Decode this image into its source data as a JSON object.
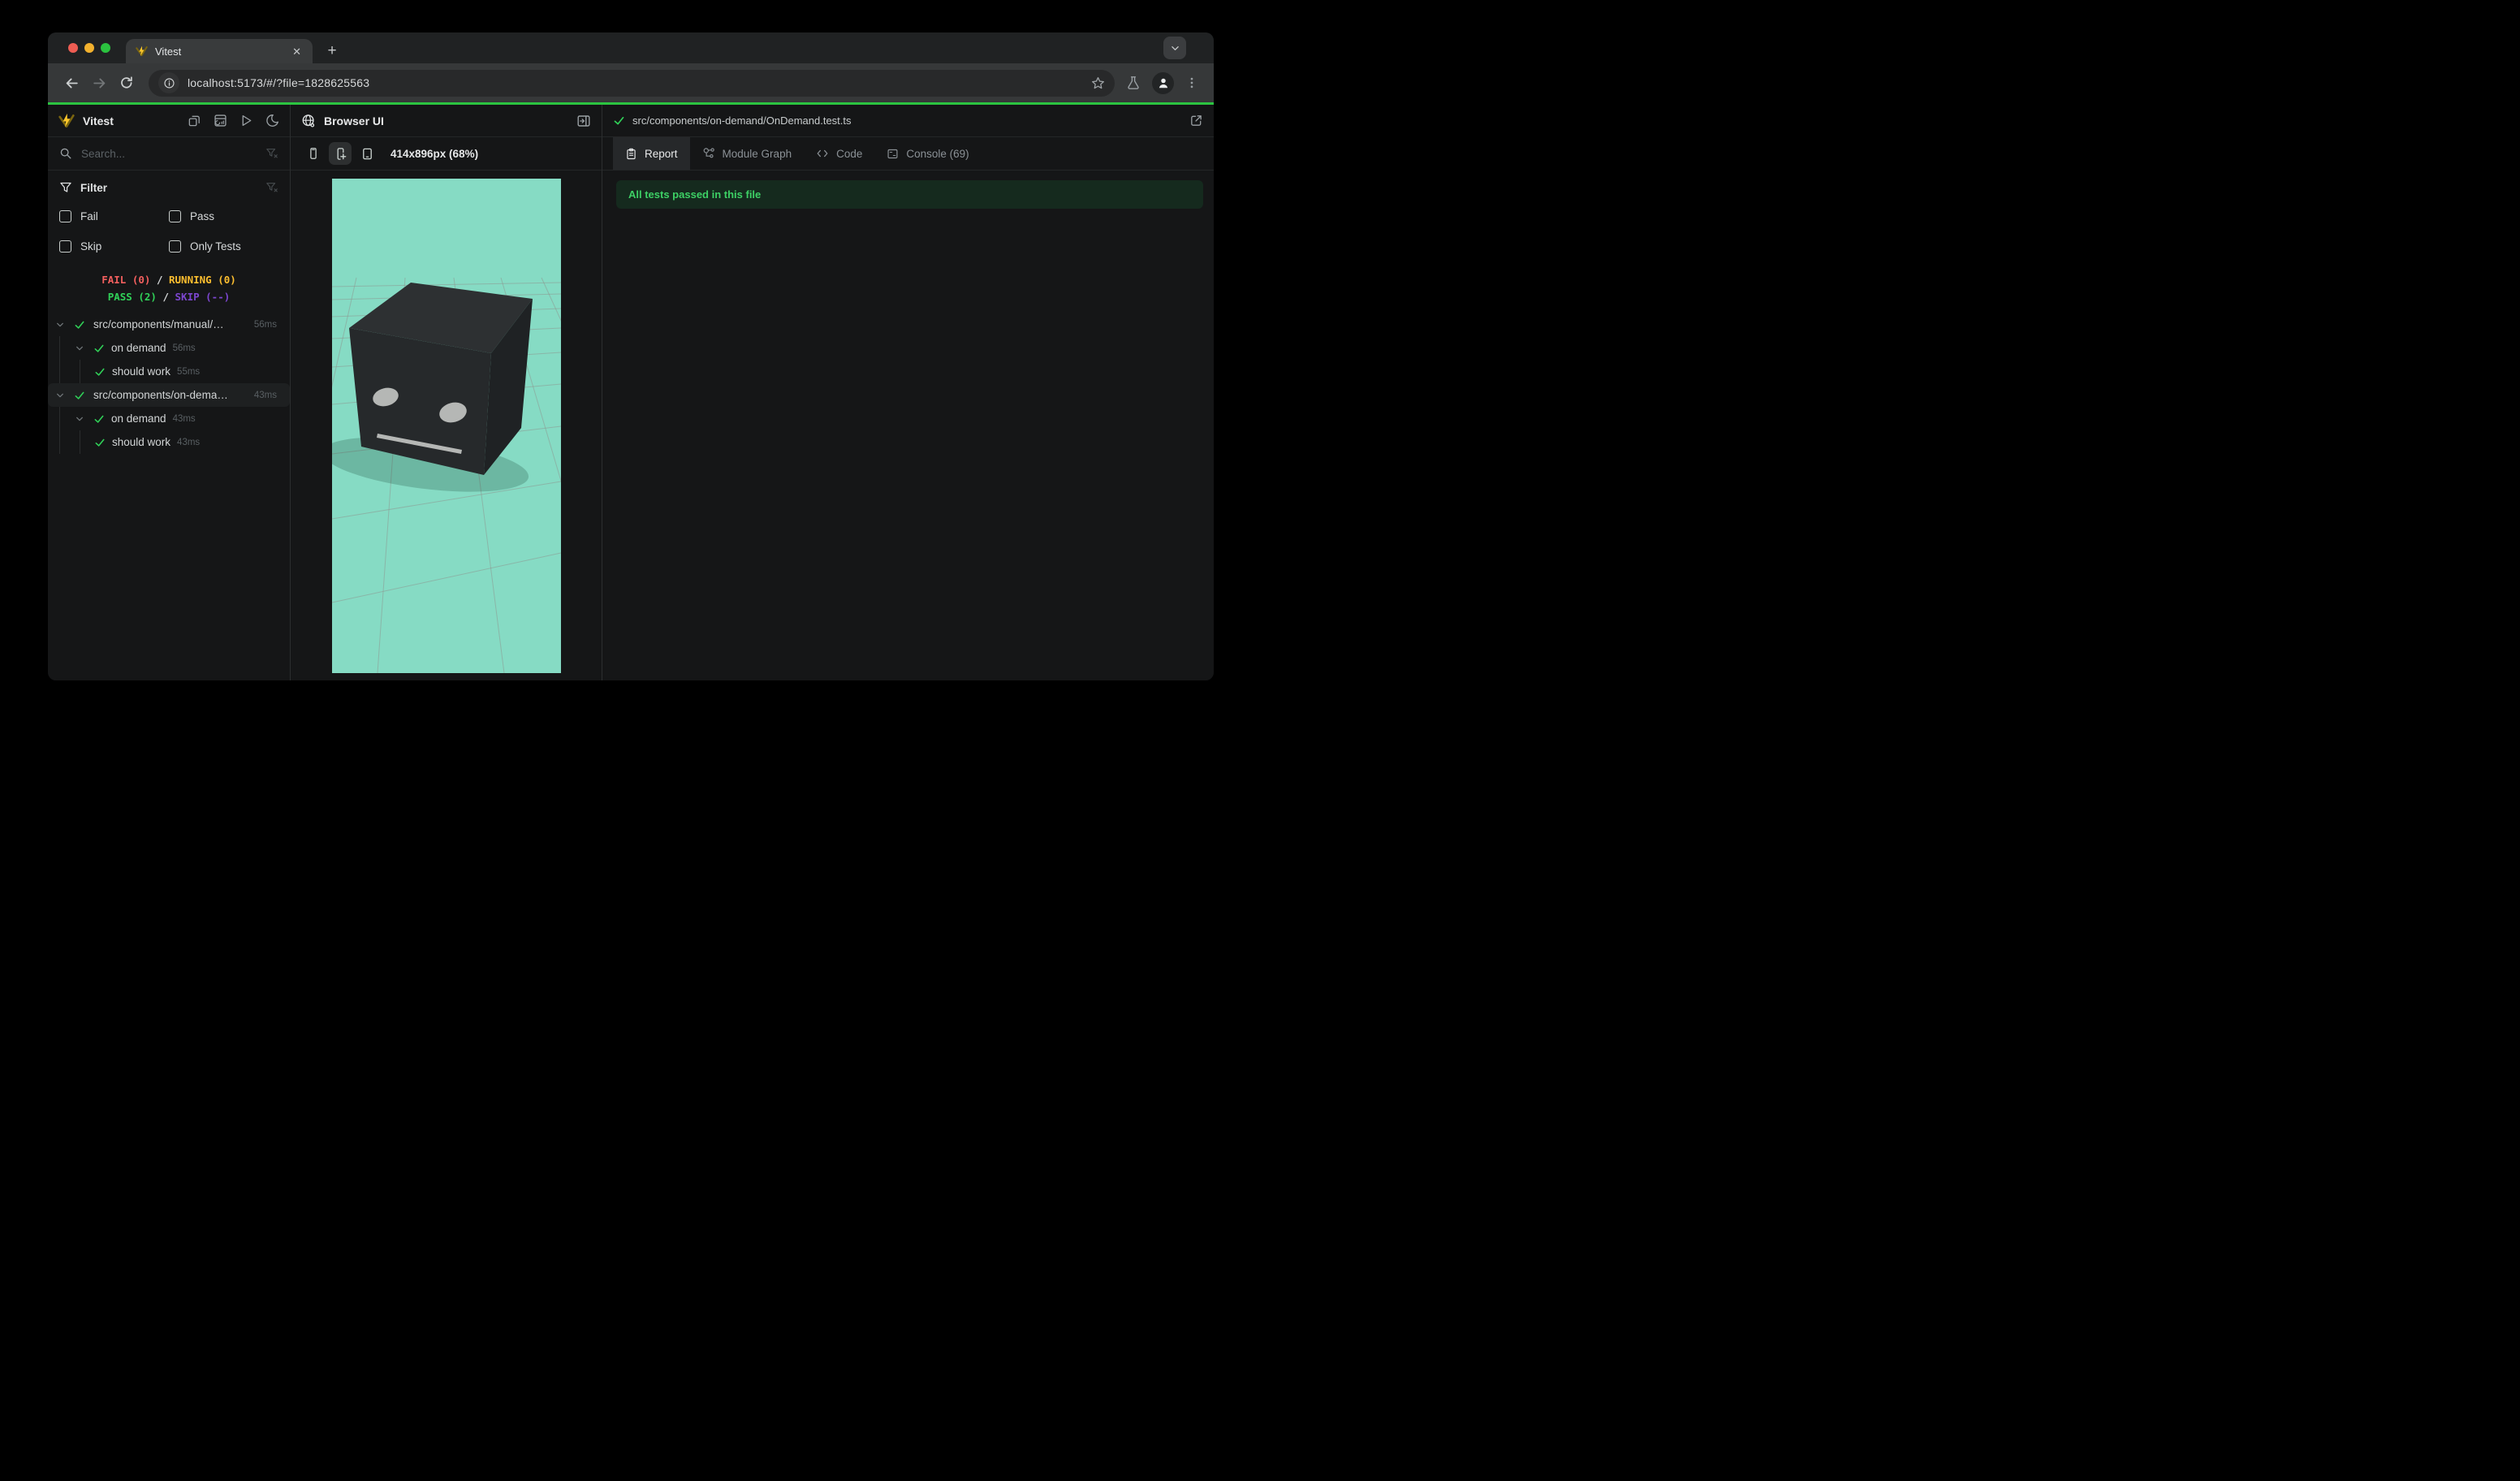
{
  "window": {
    "tab_title": "Vitest",
    "close_tab_label": "✕",
    "new_tab_label": "+",
    "url": "localhost:5173/#/?file=1828625563"
  },
  "sidebar": {
    "app_name": "Vitest",
    "search_placeholder": "Search...",
    "filter": {
      "title": "Filter",
      "fail": "Fail",
      "pass": "Pass",
      "skip": "Skip",
      "only_tests": "Only Tests"
    },
    "stats": {
      "fail": "FAIL (0)",
      "sep": "/",
      "running": "RUNNING (0)",
      "pass": "PASS (2)",
      "skip": "SKIP (--)"
    },
    "tree": {
      "rows": [
        {
          "label": "src/components/manual/…",
          "duration": "56ms"
        },
        {
          "label": "on demand",
          "duration": "56ms"
        },
        {
          "label": "should work",
          "duration": "55ms"
        },
        {
          "label": "src/components/on-dema…",
          "duration": "43ms"
        },
        {
          "label": "on demand",
          "duration": "43ms"
        },
        {
          "label": "should work",
          "duration": "43ms"
        }
      ]
    }
  },
  "browser_panel": {
    "title": "Browser UI",
    "resolution": "414x896px (68%)"
  },
  "report_panel": {
    "file_path": "src/components/on-demand/OnDemand.test.ts",
    "tabs": {
      "report": "Report",
      "module_graph": "Module Graph",
      "code": "Code",
      "console": "Console (69)"
    },
    "banner": "All tests passed in this file"
  },
  "colors": {
    "progress_green": "#2bc440",
    "pass_green": "#30d158",
    "fail_red": "#f25f5e",
    "running_yellow": "#fcbe2f",
    "skip_purple": "#7c46cf",
    "viewport_teal": "#86dbc4",
    "banner_bg": "#152a1e"
  }
}
